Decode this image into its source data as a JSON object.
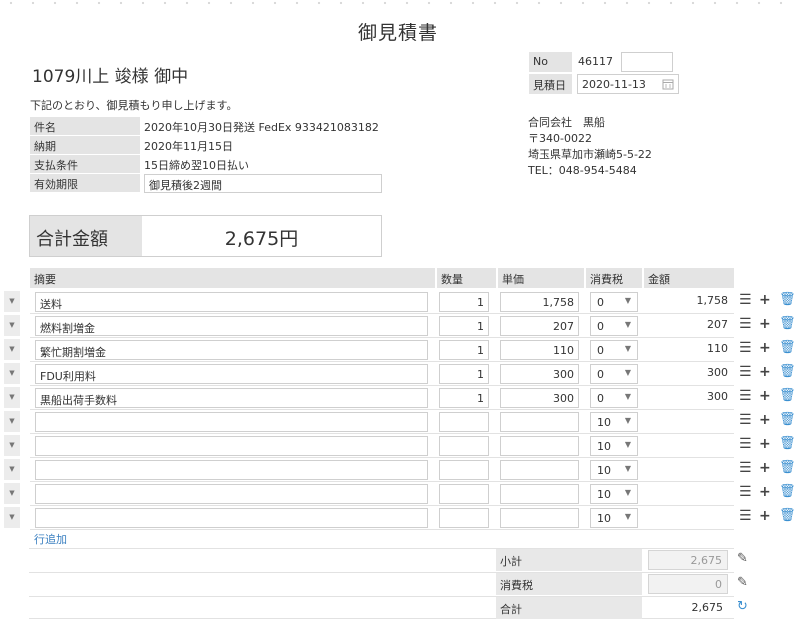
{
  "title": "御見積書",
  "customer": "1079川上 竣様 御中",
  "intro": "下記のとおり、御見積もり申し上げます。",
  "info": [
    {
      "label": "件名",
      "value": "2020年10月30日発送 FedEx 933421083182"
    },
    {
      "label": "納期",
      "value": "2020年11月15日"
    },
    {
      "label": "支払条件",
      "value": "15日締め翌10日払い"
    },
    {
      "label": "有効期限",
      "value": "御見積後2週間"
    }
  ],
  "meta": {
    "no_label": "No",
    "no_value": "46117",
    "date_label": "見積日",
    "date_value": "2020-11-13"
  },
  "company": {
    "name": "合同会社　黒船",
    "postal": "〒340-0022",
    "address": "埼玉県草加市瀬崎5-5-22",
    "tel": "TEL：048-954-5484"
  },
  "total": {
    "label": "合計金額",
    "value": "2,675円"
  },
  "columns": {
    "desc": "摘要",
    "qty": "数量",
    "unit": "単価",
    "tax": "消費税",
    "amount": "金額"
  },
  "rows": [
    {
      "desc": "送料",
      "qty": "1",
      "unit": "1,758",
      "tax": "0",
      "amount": "1,758"
    },
    {
      "desc": "燃料割増金",
      "qty": "1",
      "unit": "207",
      "tax": "0",
      "amount": "207"
    },
    {
      "desc": "繁忙期割増金",
      "qty": "1",
      "unit": "110",
      "tax": "0",
      "amount": "110"
    },
    {
      "desc": "FDU利用料",
      "qty": "1",
      "unit": "300",
      "tax": "0",
      "amount": "300"
    },
    {
      "desc": "黒船出荷手数料",
      "qty": "1",
      "unit": "300",
      "tax": "0",
      "amount": "300"
    },
    {
      "desc": "",
      "qty": "",
      "unit": "",
      "tax": "10",
      "amount": ""
    },
    {
      "desc": "",
      "qty": "",
      "unit": "",
      "tax": "10",
      "amount": ""
    },
    {
      "desc": "",
      "qty": "",
      "unit": "",
      "tax": "10",
      "amount": ""
    },
    {
      "desc": "",
      "qty": "",
      "unit": "",
      "tax": "10",
      "amount": ""
    },
    {
      "desc": "",
      "qty": "",
      "unit": "",
      "tax": "10",
      "amount": ""
    }
  ],
  "add_row": "行追加",
  "summary": {
    "subtotal_label": "小計",
    "subtotal_value": "2,675",
    "tax_label": "消費税",
    "tax_value": "0",
    "total_label": "合計",
    "total_value": "2,675"
  },
  "icons": {
    "handle": "▼",
    "menu": "☰",
    "add": "+",
    "trash": "🗑",
    "edit": "✎",
    "refresh": "↻"
  }
}
